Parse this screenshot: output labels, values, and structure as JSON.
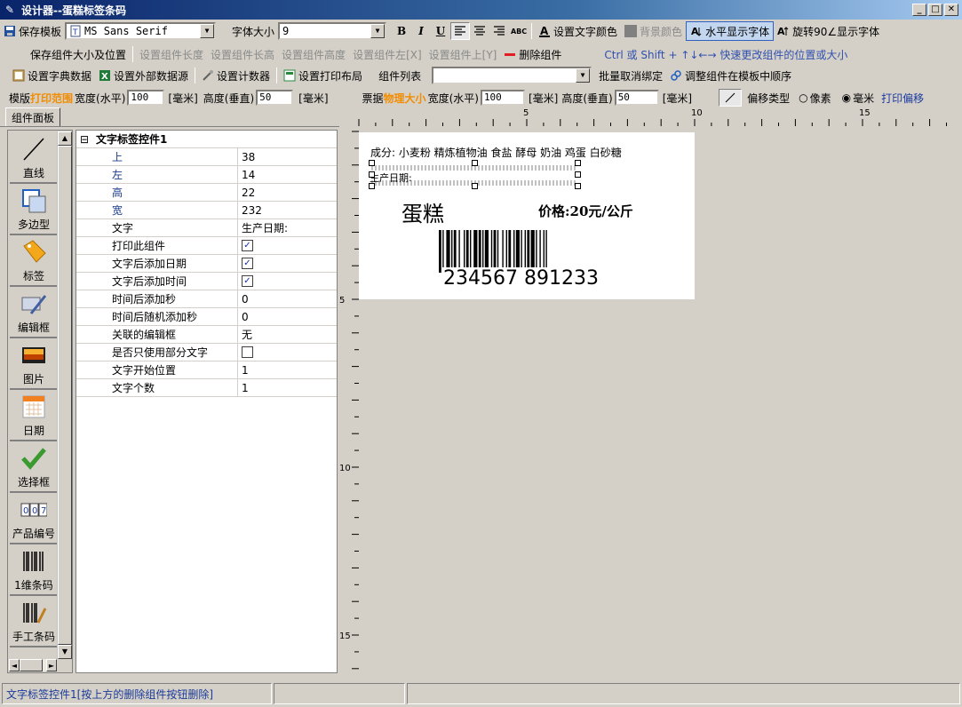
{
  "window": {
    "title": "设计器--蛋糕标签条码"
  },
  "toolbar1": {
    "save_template": "保存模板",
    "font_name": "MS Sans Serif",
    "font_size_label": "字体大小",
    "font_size": "9",
    "bold": "B",
    "italic": "I",
    "underline": "U",
    "abc": "ABC",
    "text_color": "设置文字颜色",
    "bg_color": "背景颜色",
    "horizontal_font": "水平显示字体",
    "rotate90": "旋转90∠显示字体"
  },
  "toolbar2": {
    "save_size_pos": "保存组件大小及位置",
    "set_width": "设置组件长度",
    "set_height_len": "设置组件长高",
    "set_height": "设置组件高度",
    "set_left": "设置组件左[X]",
    "set_top": "设置组件上[Y]",
    "delete": "删除组件",
    "hint": "Ctrl 或 Shift + ↑↓←→  快速更改组件的位置或大小"
  },
  "toolbar3": {
    "dict_data": "设置字典数据",
    "external_data": "设置外部数据源",
    "counter": "设置计数器",
    "print_layout": "设置打印布局",
    "component_list": "组件列表",
    "batch_unbind": "批量取消绑定",
    "adjust_order": "调整组件在模板中顺序"
  },
  "toolbar4": {
    "template_prefix": "模版",
    "print_range": "打印范围",
    "width_label": "宽度(水平)",
    "width_value": "100",
    "unit_mm1": "[毫米]",
    "height_label": "高度(垂直)",
    "height_value": "50",
    "unit_mm2": "[毫米]",
    "ticket_prefix": "票据",
    "physical_size": "物理大小",
    "p_width_label": "宽度(水平)",
    "p_width_value": "100",
    "unit_mm3": "[毫米]",
    "p_height_label": "高度(垂直)",
    "p_height_value": "50",
    "unit_mm4": "[毫米]",
    "offset_type": "偏移类型",
    "pixel": "像素",
    "mm": "毫米",
    "print_offset": "打印偏移"
  },
  "tabs": {
    "component_panel": "组件面板"
  },
  "tools": [
    {
      "label": "直线"
    },
    {
      "label": "多边型"
    },
    {
      "label": "标签"
    },
    {
      "label": "编辑框"
    },
    {
      "label": "图片"
    },
    {
      "label": "日期"
    },
    {
      "label": "选择框"
    },
    {
      "label": "产品编号"
    },
    {
      "label": "1维条码"
    },
    {
      "label": "手工条码"
    }
  ],
  "properties": {
    "header": "文字标签控件1",
    "rows": [
      {
        "name": "上",
        "value": "38",
        "type": "text"
      },
      {
        "name": "左",
        "value": "14",
        "type": "text"
      },
      {
        "name": "高",
        "value": "22",
        "type": "text"
      },
      {
        "name": "宽",
        "value": "232",
        "type": "text"
      },
      {
        "name": "文字",
        "value": "生产日期:",
        "type": "text"
      },
      {
        "name": "打印此组件",
        "value": "true",
        "type": "check"
      },
      {
        "name": "文字后添加日期",
        "value": "true",
        "type": "check"
      },
      {
        "name": "文字后添加时间",
        "value": "true",
        "type": "check"
      },
      {
        "name": "时间后添加秒",
        "value": "0",
        "type": "text"
      },
      {
        "name": "时间后随机添加秒",
        "value": "0",
        "type": "text"
      },
      {
        "name": "关联的编辑框",
        "value": "无",
        "type": "text"
      },
      {
        "name": "是否只使用部分文字",
        "value": "false",
        "type": "check"
      },
      {
        "name": "文字开始位置",
        "value": "1",
        "type": "text"
      },
      {
        "name": "文字个数",
        "value": "1",
        "type": "text"
      }
    ]
  },
  "ruler": {
    "h_ticks": [
      "5",
      "10",
      "15"
    ],
    "v_ticks": [
      "5",
      "10",
      "15"
    ]
  },
  "label": {
    "ingredients": "成分: 小麦粉  精炼植物油 食盐 酵母 奶油  鸡蛋 白砂糖",
    "production_date": "生产日期:",
    "product_name": "蛋糕",
    "price": "价格:20元/公斤",
    "barcode_number": "234567 891233"
  },
  "status": {
    "message": "文字标签控件1[按上方的删除组件按钮删除]"
  }
}
